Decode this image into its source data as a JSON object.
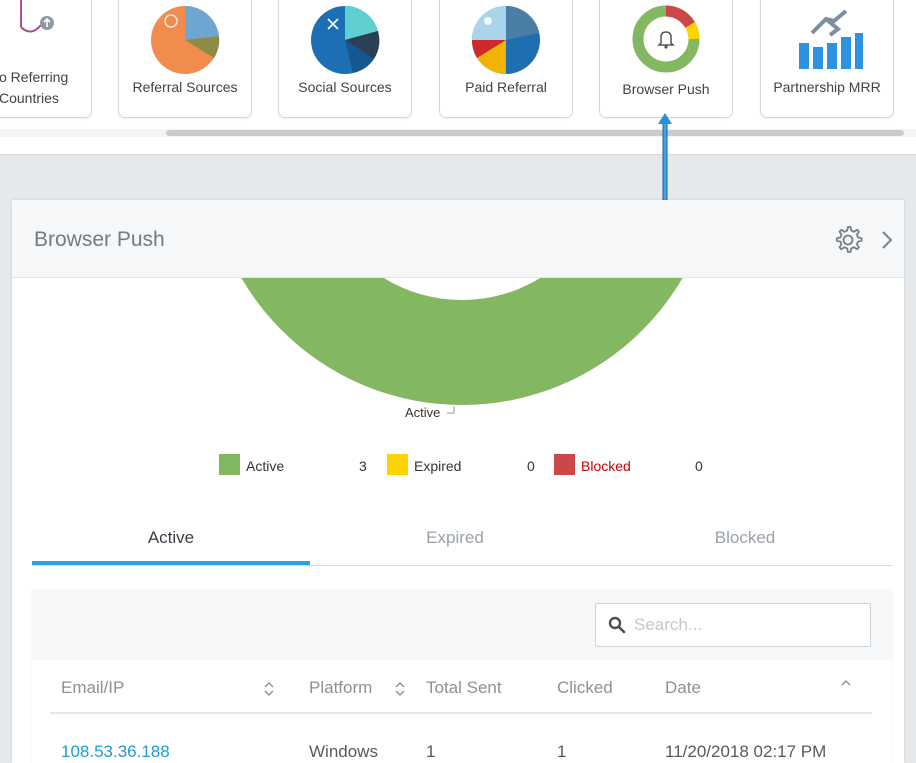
{
  "carousel": {
    "cards": [
      {
        "label": "Top Referring\nCountries",
        "label_visible": "o Referring Countries",
        "icon": "map-pin-icon"
      },
      {
        "label": "Referral Sources",
        "icon": "referral-pie-icon"
      },
      {
        "label": "Social Sources",
        "icon": "social-pie-icon"
      },
      {
        "label": "Paid Referral",
        "icon": "paid-pie-icon"
      },
      {
        "label": "Browser Push",
        "icon": "bell-donut-icon"
      },
      {
        "label": "Partnership MRR",
        "icon": "handshake-bars-icon"
      }
    ],
    "partial_line1": "o Referring",
    "partial_line2": "Countries"
  },
  "panel": {
    "title": "Browser Push"
  },
  "chart_data": {
    "type": "pie",
    "categories": [
      "Active",
      "Expired",
      "Blocked"
    ],
    "values": [
      3,
      0,
      0
    ],
    "colors": [
      "#84b761",
      "#fdd400",
      "#cc4748"
    ],
    "slice_label": "Active"
  },
  "legend": [
    {
      "label": "Active",
      "count": "3",
      "color": "#84b761",
      "label_color": "#333333"
    },
    {
      "label": "Expired",
      "count": "0",
      "color": "#fdd400",
      "label_color": "#333333"
    },
    {
      "label": "Blocked",
      "count": "0",
      "color": "#cc4748",
      "label_color": "#cc0000"
    }
  ],
  "tabs": [
    {
      "label": "Active",
      "active": true
    },
    {
      "label": "Expired",
      "active": false
    },
    {
      "label": "Blocked",
      "active": false
    }
  ],
  "search": {
    "placeholder": "Search..."
  },
  "table": {
    "columns": [
      "Email/IP",
      "Platform",
      "Total Sent",
      "Clicked",
      "Date"
    ],
    "rows": [
      [
        "108.53.36.188",
        "Windows",
        "1",
        "1",
        "11/20/2018 02:17 PM"
      ]
    ]
  },
  "colors": {
    "accent": "#29a3e0",
    "link": "#1e9ad6",
    "annotation": "#2b8fd6"
  }
}
